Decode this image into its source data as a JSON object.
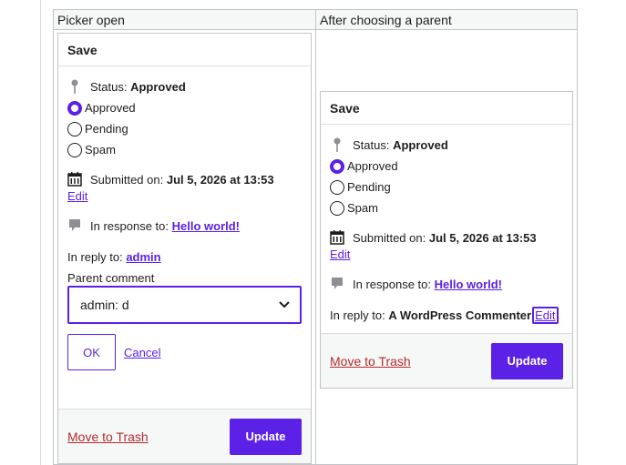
{
  "columns": {
    "left_header": "Picker open",
    "right_header": "After choosing a parent"
  },
  "left_box": {
    "title": "Save",
    "status_label": "Status:",
    "status_value": "Approved",
    "radios": [
      "Approved",
      "Pending",
      "Spam"
    ],
    "submitted_label": "Submitted on:",
    "submitted_value": "Jul 5, 2026 at 13:53",
    "edit_link": "Edit",
    "in_response_label": "In response to:",
    "in_response_link": "Hello world!",
    "in_reply_label": "In reply to:",
    "in_reply_link": "admin",
    "parent_comment_label": "Parent comment",
    "parent_comment_selected": "admin: d",
    "ok_button": "OK",
    "cancel_link": "Cancel",
    "trash_link": "Move to Trash",
    "update_button": "Update"
  },
  "right_box": {
    "title": "Save",
    "status_label": "Status:",
    "status_value": "Approved",
    "radios": [
      "Approved",
      "Pending",
      "Spam"
    ],
    "submitted_label": "Submitted on:",
    "submitted_value": "Jul 5, 2026 at 13:53",
    "edit_link": "Edit",
    "in_response_label": "In response to:",
    "in_response_link": "Hello world!",
    "in_reply_label": "In reply to:",
    "in_reply_value": "A WordPress Commenter",
    "in_reply_edit_link": "Edit",
    "trash_link": "Move to Trash",
    "update_button": "Update"
  },
  "colors": {
    "accent": "#5b21e6",
    "danger": "#b32d2e"
  }
}
